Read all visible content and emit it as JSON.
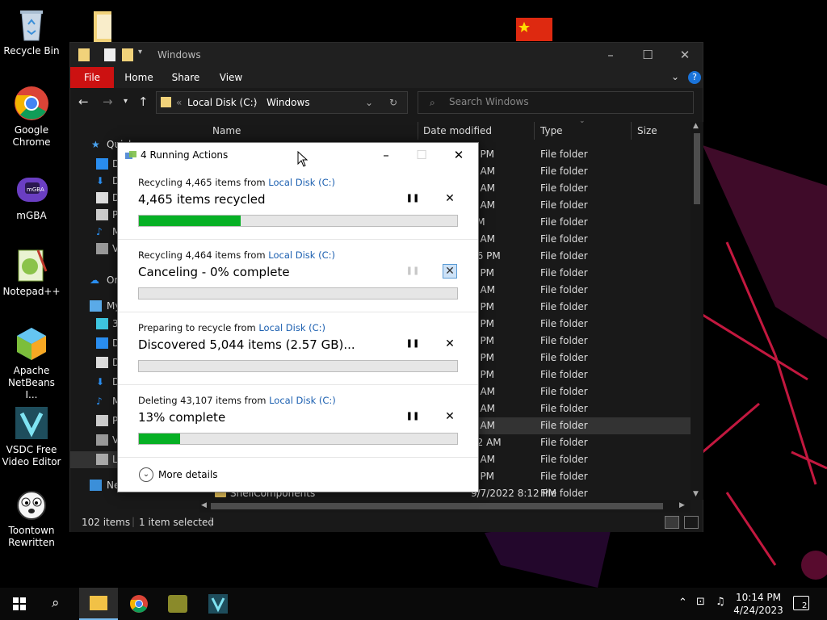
{
  "desktop": {
    "icons": [
      {
        "label": "Recycle Bin"
      },
      {
        "label": "Google Chrome"
      },
      {
        "label": "mGBA"
      },
      {
        "label": "Notepad++"
      },
      {
        "label": "Apache NetBeans I..."
      },
      {
        "label": "VSDC Free Video Editor"
      },
      {
        "label": "Toontown Rewritten"
      }
    ]
  },
  "explorer": {
    "title": "Windows",
    "ribbon_tabs": [
      "File",
      "Home",
      "Share",
      "View"
    ],
    "address": {
      "prefix": "«",
      "segments": [
        "Local Disk (C:)",
        "Windows"
      ]
    },
    "search_placeholder": "Search Windows",
    "nav_items": [
      "Quick access",
      "D",
      "D",
      "D",
      "P",
      "M",
      "V",
      "On",
      "My",
      "3",
      "D",
      "D",
      "D",
      "M",
      "P",
      "V",
      "L",
      "Network"
    ],
    "columns": {
      "name": "Name",
      "date": "Date modified",
      "type": "Type",
      "size": "Size"
    },
    "rows": [
      {
        "date": "3 PM",
        "type": "File folder"
      },
      {
        "date": "1 AM",
        "type": "File folder"
      },
      {
        "date": "4 AM",
        "type": "File folder"
      },
      {
        "date": "4 AM",
        "type": "File folder"
      },
      {
        "date": "PM",
        "type": "File folder"
      },
      {
        "date": "4 AM",
        "type": "File folder"
      },
      {
        "date": "06 PM",
        "type": "File folder"
      },
      {
        "date": "4 PM",
        "type": "File folder"
      },
      {
        "date": "4 AM",
        "type": "File folder"
      },
      {
        "date": "3 PM",
        "type": "File folder"
      },
      {
        "date": "2 PM",
        "type": "File folder"
      },
      {
        "date": "4 PM",
        "type": "File folder"
      },
      {
        "date": "4 PM",
        "type": "File folder"
      },
      {
        "date": "6 PM",
        "type": "File folder"
      },
      {
        "date": "4 AM",
        "type": "File folder"
      },
      {
        "date": "4 AM",
        "type": "File folder"
      },
      {
        "date": "4 AM",
        "type": "File folder",
        "selected": true
      },
      {
        "date": "22 AM",
        "type": "File folder"
      },
      {
        "date": "1 AM",
        "type": "File folder"
      },
      {
        "date": "2 PM",
        "type": "File folder"
      },
      {
        "name": "ShellComponents",
        "date": "9/7/2022 8:12 PM",
        "type": "File folder"
      }
    ],
    "status": {
      "count": "102 items",
      "selected": "1 item selected"
    }
  },
  "dialog": {
    "title": "4 Running Actions",
    "operations": [
      {
        "desc_prefix": "Recycling 4,465 items from ",
        "link": "Local Disk (C:)",
        "status": "4,465 items recycled",
        "progress": 0.32,
        "paused_disabled": false,
        "cancel_active": false
      },
      {
        "desc_prefix": "Recycling 4,464 items from ",
        "link": "Local Disk (C:)",
        "status": "Canceling - 0% complete",
        "progress": 0.0,
        "paused_disabled": true,
        "cancel_active": true
      },
      {
        "desc_prefix": "Preparing to recycle from ",
        "link": "Local Disk (C:)",
        "status": "Discovered 5,044 items (2.57 GB)...",
        "progress": 0.0,
        "paused_disabled": false,
        "cancel_active": false
      },
      {
        "desc_prefix": "Deleting 43,107 items from ",
        "link": "Local Disk (C:)",
        "status": "13% complete",
        "progress": 0.13,
        "paused_disabled": false,
        "cancel_active": false
      }
    ],
    "more_details": "More details"
  },
  "taskbar": {
    "time": "10:14 PM",
    "date": "4/24/2023",
    "notifications": "2"
  },
  "colors": {
    "accent_red": "#cc1111",
    "progress_green": "#06b025",
    "link_blue": "#1b5fb0"
  }
}
